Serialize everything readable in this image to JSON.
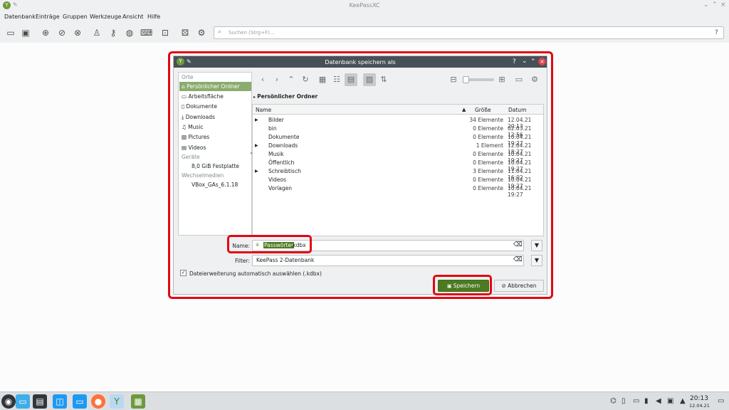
{
  "window": {
    "title": "KeePassXC"
  },
  "menu": [
    "Datenbank",
    "Einträge",
    "Gruppen",
    "Werkzeuge",
    "Ansicht",
    "Hilfe"
  ],
  "search": {
    "placeholder": "Suchen (Strg+F)...",
    "help": "?"
  },
  "dialog": {
    "title": "Datenbank speichern als",
    "title_buttons": [
      "?",
      "⌄",
      "⌃",
      "×"
    ],
    "places": {
      "header": "Orte",
      "items": [
        "Persönlicher Ordner",
        "Arbeitsfläche",
        "Dokumente",
        "Downloads",
        "Music",
        "Pictures",
        "Videos"
      ],
      "devices_header": "Geräte",
      "devices": [
        "8,0 GiB Festplatte"
      ],
      "removable_header": "Wechselmedien",
      "removable": [
        "VBox_GAs_6.1.18"
      ]
    },
    "breadcrumb": "Persönlicher Ordner",
    "columns": [
      "Name",
      "Größe",
      "Datum"
    ],
    "files": [
      {
        "name": "Bilder",
        "size": "34 Elemente",
        "date": "12.04.21 20:13",
        "expand": "▶"
      },
      {
        "name": "bin",
        "size": "0 Elemente",
        "date": "02.03.21 12:56",
        "expand": ""
      },
      {
        "name": "Dokumente",
        "size": "0 Elemente",
        "date": "10.04.21 19:27",
        "expand": ""
      },
      {
        "name": "Downloads",
        "size": "1 Element",
        "date": "12.04.21 18:27",
        "expand": "▶"
      },
      {
        "name": "Musik",
        "size": "0 Elemente",
        "date": "10.04.21 19:27",
        "expand": ""
      },
      {
        "name": "Öffentlich",
        "size": "0 Elemente",
        "date": "10.04.21 19:27",
        "expand": ""
      },
      {
        "name": "Schreibtisch",
        "size": "3 Elemente",
        "date": "11.04.21 16:02",
        "expand": "▶"
      },
      {
        "name": "Videos",
        "size": "0 Elemente",
        "date": "10.04.21 19:27",
        "expand": ""
      },
      {
        "name": "Vorlagen",
        "size": "0 Elemente",
        "date": "10.04.21 19:27",
        "expand": ""
      }
    ],
    "name_label": "Name:",
    "name_selected": "Passwörter",
    "name_rest": ".kdbx",
    "filter_label": "Filter:",
    "filter_value": "KeePass 2-Datenbank",
    "auto_ext_label": "Dateierweiterung automatisch auswählen (.kdbx)",
    "save_label": "Speichern",
    "cancel_label": "Abbrechen"
  },
  "clock": {
    "time": "20:13",
    "date": "12.04.21"
  },
  "colors": {
    "accent": "#8aac6e",
    "save": "#4c7a21",
    "highlight": "#e30613"
  }
}
